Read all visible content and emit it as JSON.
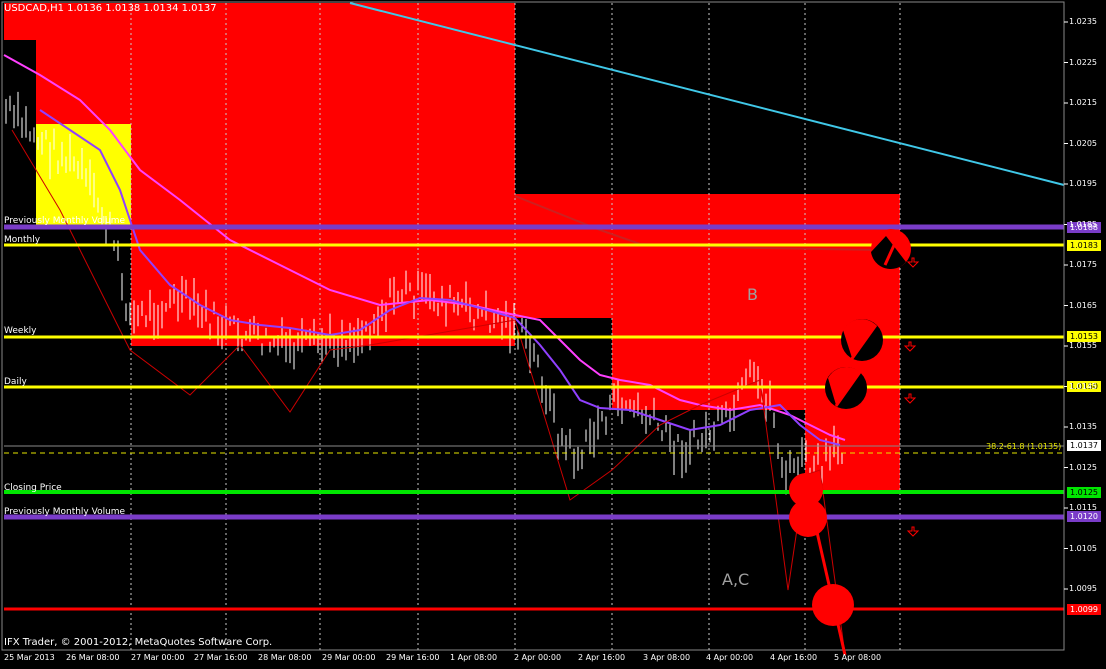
{
  "header": {
    "title": "USDCAD,H1  1.0136 1.0138 1.0134 1.0137"
  },
  "levels": {
    "prev_monthly_volume_top": {
      "label": "Previously Monthly Volume",
      "price": "1.0188",
      "color": "#7a3cc8"
    },
    "monthly": {
      "label": "Monthly",
      "price": "1.0183",
      "color": "#ffff00"
    },
    "weekly": {
      "label": "Weekly",
      "price": "1.0153",
      "color": "#ffff00"
    },
    "daily": {
      "label": "Daily",
      "price": "1.0150",
      "color": "#ffff00"
    },
    "current": {
      "price": "1.0137",
      "color": "#ffffff"
    },
    "closing_price": {
      "label": "Closing Price",
      "price": "1.0125",
      "color": "#00e600"
    },
    "prev_monthly_volume_bottom": {
      "label": "Previously Monthly Volume",
      "price": "1.0120",
      "color": "#7a3cc8"
    },
    "red_line": {
      "price": "1.0099",
      "color": "#ff0000"
    }
  },
  "fib_label": "38.2-61.8 (1.0135)",
  "annotations": {
    "b": "B",
    "ac": "A,C"
  },
  "y_ticks": [
    "1.0235",
    "1.0225",
    "1.0215",
    "1.0205",
    "1.0195",
    "1.0185",
    "1.0175",
    "1.0165",
    "1.0155",
    "1.0145",
    "1.0135",
    "1.0125",
    "1.0115",
    "1.0105",
    "1.0095"
  ],
  "x_ticks": [
    "25 Mar 2013",
    "26 Mar 08:00",
    "27 Mar 00:00",
    "27 Mar 16:00",
    "28 Mar 08:00",
    "29 Mar 00:00",
    "29 Mar 16:00",
    "1 Apr 08:00",
    "2 Apr 00:00",
    "2 Apr 16:00",
    "3 Apr 08:00",
    "4 Apr 00:00",
    "4 Apr 16:00",
    "5 Apr 08:00"
  ],
  "footer": {
    "copyright": "IFX Trader, © 2001-2012, MetaQuotes Software Corp."
  },
  "colors": {
    "background": "#000000",
    "zone": "#ff0000",
    "zone_yellow": "#ffff00",
    "trendline": "#40c8e8",
    "ma_pink": "#ff40ff",
    "ma_purple": "#9040ff"
  }
}
